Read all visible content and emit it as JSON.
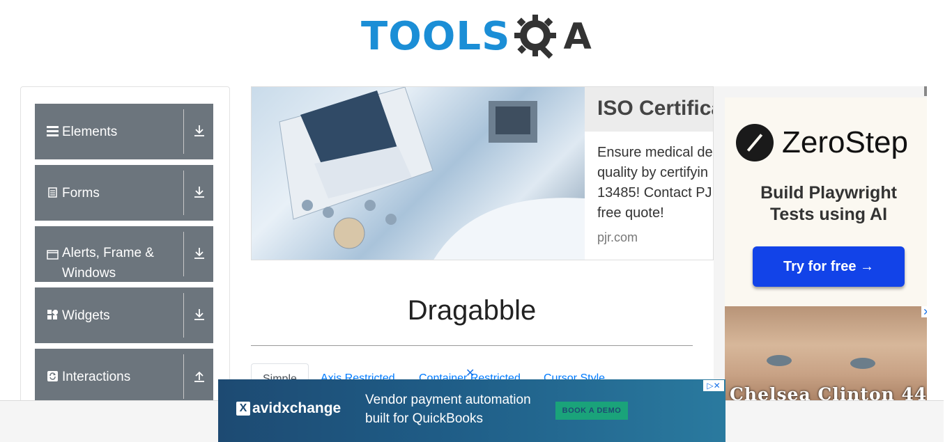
{
  "header": {
    "logo_part1": "TOOLS",
    "logo_part2": "QA"
  },
  "sidebar": {
    "groups": [
      {
        "label": "Elements",
        "icon": "menu-icon",
        "arrow": "download-arrow-icon"
      },
      {
        "label": "Forms",
        "icon": "document-icon",
        "arrow": "download-arrow-icon"
      },
      {
        "label": "Alerts, Frame & Windows",
        "icon": "window-icon",
        "arrow": "download-arrow-icon"
      },
      {
        "label": "Widgets",
        "icon": "widgets-icon",
        "arrow": "download-arrow-icon"
      },
      {
        "label": "Interactions",
        "icon": "refresh-icon",
        "arrow": "upload-arrow-icon"
      }
    ]
  },
  "ad_main": {
    "title": "ISO Certifica",
    "body": "Ensure medical de\nquality by certifyin\n13485! Contact PJ\nfree quote!",
    "domain": "pjr.com"
  },
  "main": {
    "title": "Dragabble",
    "tabs": [
      {
        "label": "Simple",
        "active": true
      },
      {
        "label": "Axis Restricted",
        "active": false
      },
      {
        "label": "Container Restricted",
        "active": false
      },
      {
        "label": "Cursor Style",
        "active": false
      }
    ]
  },
  "ad_right": {
    "brand": "ZeroStep",
    "tagline": "Build Playwright\nTests using AI",
    "cta": "Try for free →",
    "photo_caption": "Chelsea Clinton 44,",
    "close": "✕"
  },
  "ad_bottom": {
    "brand": "avidxchange",
    "brand_mark": "X",
    "copy": "Vendor payment automation\nbuilt for QuickBooks",
    "cta": "BOOK A DEMO",
    "adchoices": "▷✕",
    "floating_close": "✕"
  },
  "colors": {
    "logo_blue": "#1b8ed6",
    "sidebar_group": "#6c757d",
    "tab_link": "#007bff",
    "zerostep_button": "#1243e8"
  }
}
